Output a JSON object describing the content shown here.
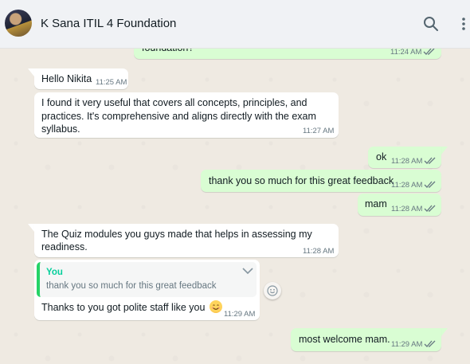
{
  "header": {
    "title": "K Sana ITIL 4 Foundation",
    "search_icon": "search-icon",
    "menu_icon": "more-vertical-icon"
  },
  "messages": [
    {
      "direction": "out",
      "text": "foundation?",
      "time": "11:24 AM",
      "ticks": "read"
    },
    {
      "direction": "in",
      "text": "Hello Nikita",
      "time": "11:25 AM"
    },
    {
      "direction": "in",
      "lines": [
        "I found it very useful that covers all concepts, principles, and",
        "practices. It's comprehensive and aligns directly with the exam",
        "syllabus."
      ],
      "time": "11:27 AM"
    },
    {
      "direction": "out",
      "text": "ok",
      "time": "11:28 AM",
      "ticks": "read"
    },
    {
      "direction": "out",
      "text": "thank you so much for this great feedback",
      "time": "11:28 AM",
      "ticks": "read"
    },
    {
      "direction": "out",
      "text": "mam",
      "time": "11:28 AM",
      "ticks": "read"
    },
    {
      "direction": "in",
      "lines": [
        "The Quiz modules you guys made that  helps in assessing my",
        "readiness."
      ],
      "time": "11:28 AM"
    },
    {
      "direction": "in",
      "quote": {
        "author": "You",
        "text": "thank you so much for this great feedback"
      },
      "text": "Thanks to you got polite staff like you",
      "emoji": "smiling-face-emoji",
      "time": "11:29 AM"
    },
    {
      "direction": "out",
      "text": "most welcome mam.",
      "time": "11:29 AM",
      "ticks": "read"
    }
  ],
  "colors": {
    "incoming_bubble": "#ffffff",
    "outgoing_bubble": "#d9fdd3",
    "read_ticks": "#53bdeb",
    "quote_accent": "#06cf9c",
    "chat_background": "#efeae2"
  }
}
